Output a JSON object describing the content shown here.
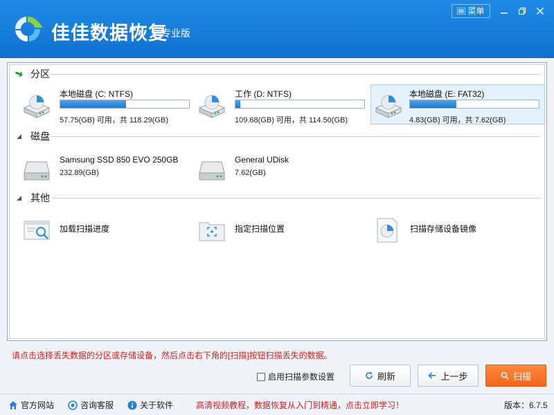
{
  "app": {
    "name": "佳佳数据恢复",
    "edition": "专业版",
    "menu_label": "菜单"
  },
  "sections": {
    "partitions": "分区",
    "disks": "磁盘",
    "others": "其他"
  },
  "partitions": [
    {
      "name": "本地磁盘 (C: NTFS)",
      "usage": "57.75(GB) 可用，共 118.29(GB)",
      "used_fraction": 0.51,
      "selected": false
    },
    {
      "name": "工作 (D: NTFS)",
      "usage": "109.68(GB) 可用，共 114.50(GB)",
      "used_fraction": 0.04,
      "selected": false
    },
    {
      "name": "本地磁盘 (E: FAT32)",
      "usage": "4.83(GB) 可用，共 7.62(GB)",
      "used_fraction": 0.36,
      "selected": true
    }
  ],
  "disks": [
    {
      "name": "Samsung SSD 850 EVO 250GB",
      "size": "232.89(GB)"
    },
    {
      "name": "General UDisk",
      "size": "7.62(GB)"
    }
  ],
  "others": [
    {
      "label": "加载扫描进度",
      "icon": "load-progress-icon"
    },
    {
      "label": "指定扫描位置",
      "icon": "scan-location-icon"
    },
    {
      "label": "扫描存储设备镜像",
      "icon": "device-image-icon"
    }
  ],
  "footer": {
    "hint": "请点击选择丢失数据的分区或存储设备，然后点击右下角的[扫描]按钮扫描丢失的数据。",
    "checkbox_label": "启用扫描参数设置",
    "refresh_label": "刷新",
    "back_label": "上一步",
    "scan_label": "扫描"
  },
  "statusbar": {
    "website": "官方网站",
    "support": "咨询客服",
    "about": "关于软件",
    "promo": "高清视频教程，数据恢复从入门到精通，点击立即学习！",
    "version": "版本：6.7.5"
  },
  "colors": {
    "title_bar": "#1a7fdc",
    "progress": "#1c79d2",
    "scan_button": "#f4661a",
    "hint_text": "#d42020"
  }
}
